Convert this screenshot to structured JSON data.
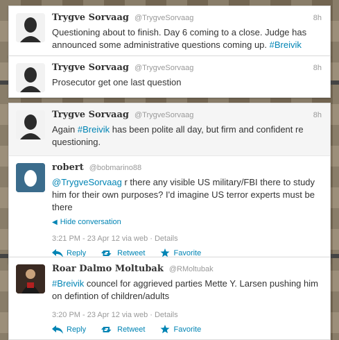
{
  "tweets": [
    {
      "fullname": "Trygve Sorvaag",
      "username": "@TrygveSorvaag",
      "time": "8h",
      "text_parts": [
        "Questioning about to finish. Day 6 coming to a close. Judge has announced some administrative questions coming up. ",
        "#Breivik"
      ]
    },
    {
      "fullname": "Trygve Sorvaag",
      "username": "@TrygveSorvaag",
      "time": "8h",
      "text": "Prosecutor get one last question"
    }
  ],
  "conversation": {
    "main": {
      "fullname": "Trygve Sorvaag",
      "username": "@TrygveSorvaag",
      "time": "8h",
      "text_parts": [
        "Again ",
        "#Breivik",
        " has been polite all day, but firm and confident re questioning."
      ]
    },
    "reply": {
      "fullname": "robert",
      "username": "@bobmarino88",
      "text_parts": [
        "@TrygveSorvaag",
        " r there any visible US military/FBI there to study him for their own purposes? I'd imagine US terror experts must be there"
      ],
      "hide_label": "Hide conversation",
      "meta": "3:21 PM - 23 Apr 12 via web · Details"
    }
  },
  "last_tweet": {
    "fullname": "Roar Dalmo Moltubak",
    "username": "@RMoltubak",
    "text_parts": [
      "#Breivik",
      " councel for aggrieved parties Mette Y. Larsen pushing him on defintion of children/adults"
    ],
    "meta": "3:20 PM - 23 Apr 12 via web · Details"
  },
  "actions": {
    "reply": "Reply",
    "retweet": "Retweet",
    "favorite": "Favorite"
  },
  "colors": {
    "link": "#0084b4",
    "muted": "#999999"
  },
  "icons": [
    "reply-icon",
    "retweet-icon",
    "star-icon",
    "arrow-left-icon"
  ]
}
